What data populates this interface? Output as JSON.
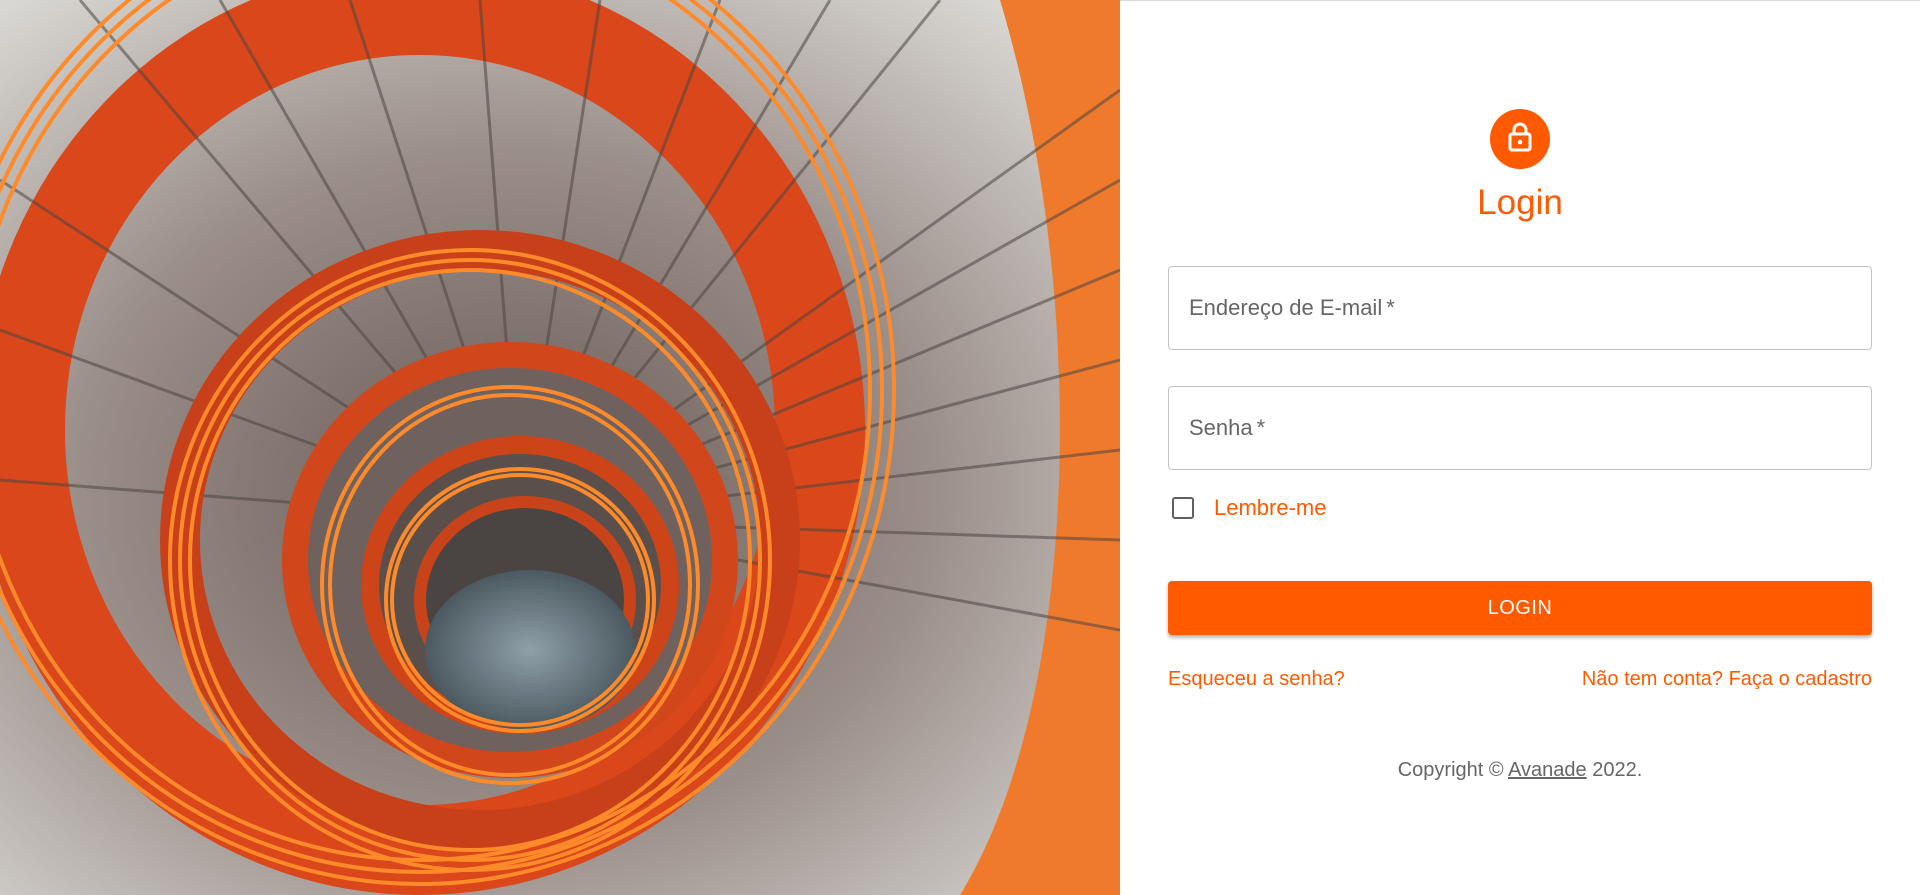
{
  "hero": {
    "image": "spiral-staircase-photo",
    "colors": {
      "railing": "#ff7a1f",
      "wall": "#e0461a",
      "steps": "#d8d6d2",
      "floor": "#6d7d86"
    }
  },
  "login": {
    "icon": "lock-icon",
    "title": "Login",
    "email_label": "Endereço de E-mail",
    "password_label": "Senha",
    "required_mark": "*",
    "email_value": "",
    "password_value": "",
    "remember_label": "Lembre-me",
    "remember_checked": false,
    "submit_label": "LOGIN",
    "forgot_link": "Esqueceu a senha?",
    "signup_link": "Não tem conta? Faça o cadastro"
  },
  "footer": {
    "copyright_prefix": "Copyright ©",
    "company": "Avanade",
    "year_suffix": "2022."
  },
  "theme": {
    "accent": "#ff5a00",
    "muted_text": "#666666",
    "border": "#c4c4c4"
  }
}
